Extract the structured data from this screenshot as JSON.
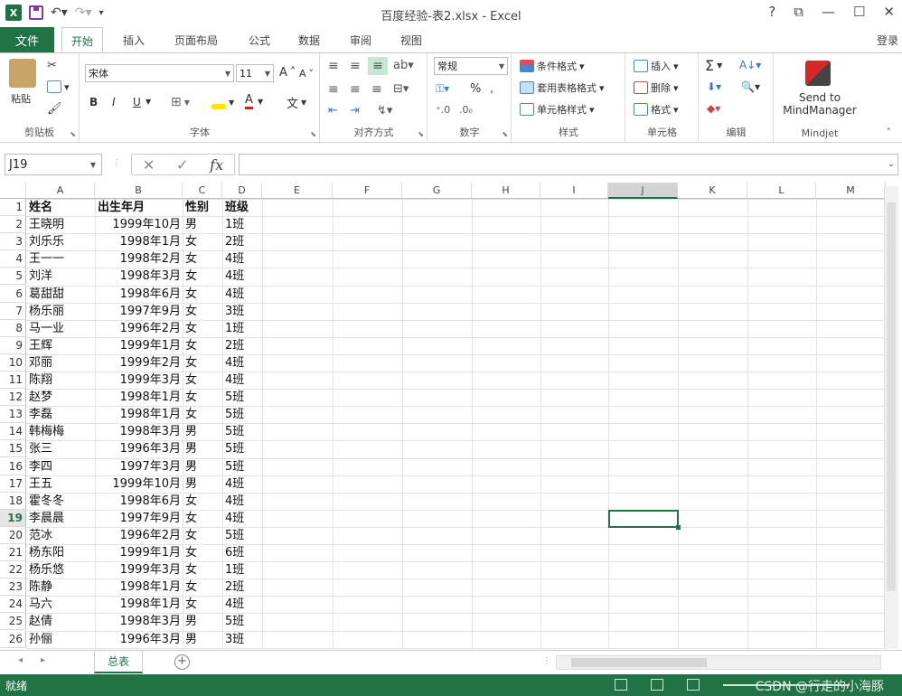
{
  "window": {
    "title": "百度经验-表2.xlsx - Excel",
    "app_icon": "X",
    "controls": [
      "?",
      "⧉",
      "—",
      "☐",
      "✕"
    ]
  },
  "tabs": {
    "file": "文件",
    "items": [
      "开始",
      "插入",
      "页面布局",
      "公式",
      "数据",
      "审阅",
      "视图"
    ],
    "active": "开始",
    "login": "登录"
  },
  "ribbon": {
    "clipboard": {
      "paste": "粘贴",
      "label": "剪贴板"
    },
    "font": {
      "name": "宋体",
      "size": "11",
      "grow": "A",
      "shrink": "A",
      "bold": "B",
      "italic": "I",
      "underline": "U",
      "label": "字体",
      "wen": "文"
    },
    "alignment": {
      "label": "对齐方式"
    },
    "number": {
      "format": "常规",
      "percent": "%",
      "label": "数字"
    },
    "styles": {
      "conditional": "条件格式",
      "table": "套用表格格式",
      "cell": "单元格样式",
      "label": "样式"
    },
    "cells": {
      "insert": "插入",
      "delete": "删除",
      "format": "格式",
      "label": "单元格"
    },
    "editing": {
      "label": "编辑",
      "sum": "Σ"
    },
    "mindjet": {
      "send1": "Send to",
      "send2": "MindManager",
      "label": "Mindjet"
    }
  },
  "formula_bar": {
    "name_box": "J19",
    "value": ""
  },
  "columns": [
    "A",
    "B",
    "C",
    "D",
    "E",
    "F",
    "G",
    "H",
    "I",
    "J",
    "K",
    "L",
    "M"
  ],
  "selected_column": "J",
  "selected_row": 19,
  "rows": [
    [
      "姓名",
      "出生年月",
      "性别",
      "班级"
    ],
    [
      "王晓明",
      "1999年10月",
      "男",
      "1班"
    ],
    [
      "刘乐乐",
      "1998年1月",
      "女",
      "2班"
    ],
    [
      "王一一",
      "1998年2月",
      "女",
      "4班"
    ],
    [
      "刘洋",
      "1998年3月",
      "女",
      "4班"
    ],
    [
      "葛甜甜",
      "1998年6月",
      "女",
      "4班"
    ],
    [
      "杨乐丽",
      "1997年9月",
      "女",
      "3班"
    ],
    [
      "马一业",
      "1996年2月",
      "女",
      "1班"
    ],
    [
      "王辉",
      "1999年1月",
      "女",
      "2班"
    ],
    [
      "邓丽",
      "1999年2月",
      "女",
      "4班"
    ],
    [
      "陈翔",
      "1999年3月",
      "女",
      "4班"
    ],
    [
      "赵梦",
      "1998年1月",
      "女",
      "5班"
    ],
    [
      "李磊",
      "1998年1月",
      "女",
      "5班"
    ],
    [
      "韩梅梅",
      "1998年3月",
      "男",
      "5班"
    ],
    [
      "张三",
      "1996年3月",
      "男",
      "5班"
    ],
    [
      "李四",
      "1997年3月",
      "男",
      "5班"
    ],
    [
      "王五",
      "1999年10月",
      "男",
      "4班"
    ],
    [
      "霍冬冬",
      "1998年6月",
      "女",
      "4班"
    ],
    [
      "李晨晨",
      "1997年9月",
      "女",
      "4班"
    ],
    [
      "范冰",
      "1996年2月",
      "女",
      "5班"
    ],
    [
      "杨东阳",
      "1999年1月",
      "女",
      "6班"
    ],
    [
      "杨乐悠",
      "1999年3月",
      "女",
      "1班"
    ],
    [
      "陈静",
      "1998年1月",
      "女",
      "2班"
    ],
    [
      "马六",
      "1998年1月",
      "女",
      "4班"
    ],
    [
      "赵倩",
      "1998年3月",
      "男",
      "5班"
    ],
    [
      "孙俪",
      "1996年3月",
      "男",
      "3班"
    ]
  ],
  "sheet": {
    "name": "总表",
    "add": "+"
  },
  "status": {
    "text": "就绪"
  },
  "watermark": "CSDN @行走的小海豚",
  "colors": {
    "accent": "#217346"
  }
}
